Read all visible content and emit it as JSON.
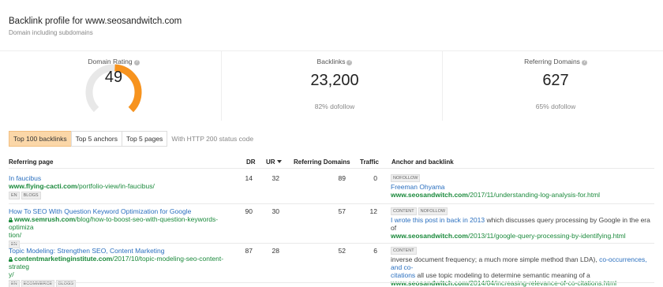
{
  "header": {
    "title": "Backlink profile for www.seosandwitch.com",
    "subtitle": "Domain including subdomains"
  },
  "metrics": {
    "domain_rating": {
      "label": "Domain Rating",
      "value": "49",
      "gauge_fraction": 0.49,
      "accent": "#f7931e"
    },
    "backlinks": {
      "label": "Backlinks",
      "value": "23,200",
      "sub": "82% dofollow"
    },
    "referring_domains": {
      "label": "Referring Domains",
      "value": "627",
      "sub": "65% dofollow"
    }
  },
  "tabs": {
    "items": [
      "Top 100 backlinks",
      "Top 5 anchors",
      "Top 5 pages"
    ],
    "active_index": 0,
    "note": "With HTTP 200 status code"
  },
  "table": {
    "columns": {
      "referring_page": "Referring page",
      "dr": "DR",
      "ur": "UR",
      "referring_domains": "Referring Domains",
      "traffic": "Traffic",
      "anchor": "Anchor and backlink"
    },
    "rows": [
      {
        "title": "In faucibus",
        "url_domain": "www.flying-cacti.com",
        "url_path": "/portfolio-view/in-faucibus/",
        "secure": false,
        "tags": [
          "EN",
          "BLOGS"
        ],
        "dr": "14",
        "ur": "32",
        "ref_domains": "89",
        "traffic": "0",
        "anchor_tags": [
          "NOFOLLOW"
        ],
        "anchor_lines": [
          {
            "text": "",
            "link": "Freeman Ohyama",
            "after": ""
          }
        ],
        "backlink_domain": "www.seosandwitch.com",
        "backlink_path": "/2017/11/understanding-log-analysis-for.html"
      },
      {
        "title": "How To SEO With Question Keyword Optimization for Google",
        "url_domain": "www.semrush.com",
        "url_path": "/blog/how-to-boost-seo-with-question-keywords-optimiza",
        "url_path2": "tion/",
        "secure": true,
        "tags": [
          "EN"
        ],
        "dr": "90",
        "ur": "30",
        "ref_domains": "57",
        "traffic": "12",
        "anchor_tags": [
          "CONTENT",
          "NOFOLLOW"
        ],
        "anchor_lines": [
          {
            "text": "",
            "link": "I wrote this post in back in 2013",
            "after": " which discusses query processing by Google in the era of"
          }
        ],
        "backlink_domain": "www.seosandwitch.com",
        "backlink_path": "/2013/11/google-query-processing-by-identifying.html"
      },
      {
        "title": "Topic Modeling: Strengthen SEO, Content Marketing",
        "url_domain": "contentmarketinginstitute.com",
        "url_path": "/2017/10/topic-modeling-seo-content-strateg",
        "url_path2": "y/",
        "secure": true,
        "tags": [
          "EN",
          "ECOMMERCE",
          "BLOGS"
        ],
        "dr": "87",
        "ur": "28",
        "ref_domains": "52",
        "traffic": "6",
        "anchor_tags": [
          "CONTENT"
        ],
        "anchor_line1_text": "inverse document frequency; a much more simple method than LDA), ",
        "anchor_line1_link": "co-occurrences, and co-",
        "anchor_line2_link": "citations",
        "anchor_line2_text": " all use topic modeling to determine semantic meaning of a",
        "backlink_domain": "www.seosandwitch.com",
        "backlink_path": "/2014/04/increasing-relevance-of-co-citations.html"
      }
    ]
  }
}
